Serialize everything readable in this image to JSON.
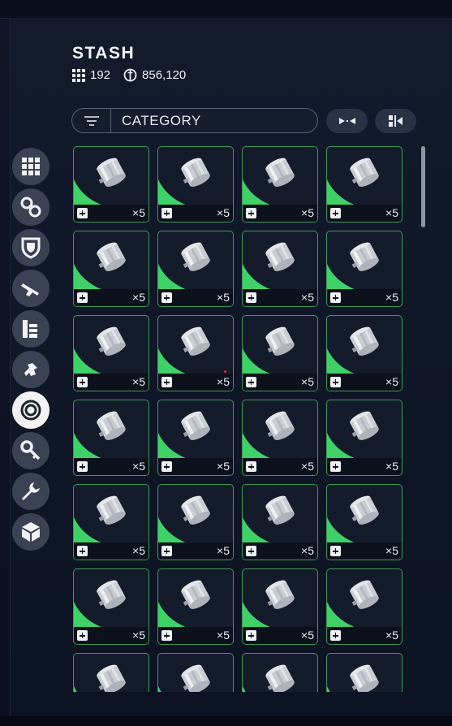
{
  "header": {
    "title": "STASH",
    "slots_value": "192",
    "currency_value": "856,120"
  },
  "filter": {
    "category_label": "CATEGORY"
  },
  "toolbar": {
    "collapse_icon": "collapse-arrows-icon",
    "sort_icon": "sort-stack-icon"
  },
  "sidebar": {
    "items": [
      {
        "icon": "grid-icon",
        "active": false
      },
      {
        "icon": "chain-icon",
        "active": false
      },
      {
        "icon": "shield-icon",
        "active": false
      },
      {
        "icon": "gun-icon",
        "active": false
      },
      {
        "icon": "books-icon",
        "active": false
      },
      {
        "icon": "bolt-icon",
        "active": false
      },
      {
        "icon": "ring-icon",
        "active": true
      },
      {
        "icon": "key-icon",
        "active": false
      },
      {
        "icon": "wrench-icon",
        "active": false
      },
      {
        "icon": "cube-icon",
        "active": false
      }
    ]
  },
  "items": [
    {
      "qty": "×5"
    },
    {
      "qty": "×5"
    },
    {
      "qty": "×5"
    },
    {
      "qty": "×5"
    },
    {
      "qty": "×5"
    },
    {
      "qty": "×5"
    },
    {
      "qty": "×5"
    },
    {
      "qty": "×5"
    },
    {
      "qty": "×5"
    },
    {
      "qty": "×5"
    },
    {
      "qty": "×5"
    },
    {
      "qty": "×5"
    },
    {
      "qty": "×5"
    },
    {
      "qty": "×5"
    },
    {
      "qty": "×5"
    },
    {
      "qty": "×5"
    },
    {
      "qty": "×5"
    },
    {
      "qty": "×5"
    },
    {
      "qty": "×5"
    },
    {
      "qty": "×5"
    },
    {
      "qty": "×5"
    },
    {
      "qty": "×5"
    },
    {
      "qty": "×5"
    },
    {
      "qty": "×5"
    },
    {
      "qty": ""
    },
    {
      "qty": ""
    },
    {
      "qty": ""
    },
    {
      "qty": ""
    }
  ],
  "colors": {
    "rarity_green": "#3fd168",
    "tile_border": "#3f9a58"
  }
}
